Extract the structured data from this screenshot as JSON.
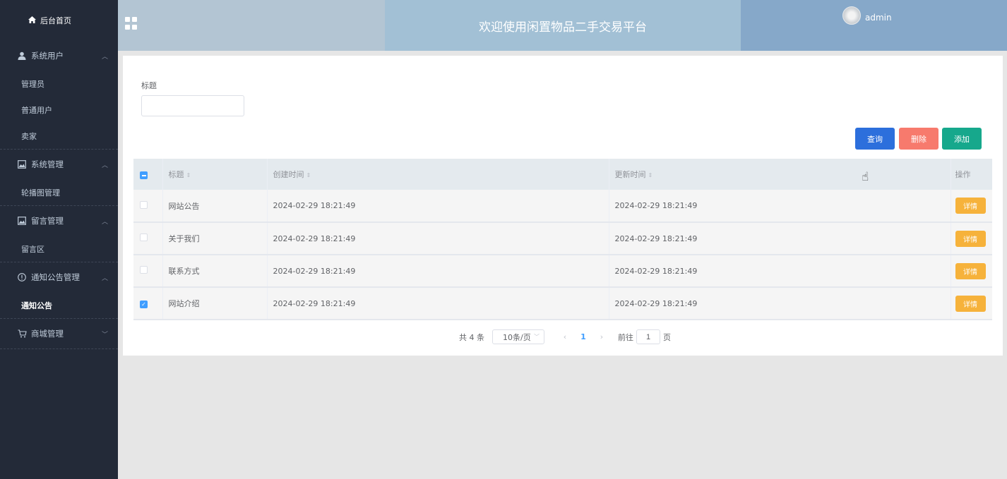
{
  "sidebar": {
    "home_label": "后台首页",
    "groups": [
      {
        "label": "系统用户",
        "icon": "user-icon",
        "items": [
          "管理员",
          "普通用户",
          "卖家"
        ]
      },
      {
        "label": "系统管理",
        "icon": "picture-icon",
        "items": [
          "轮播图管理"
        ]
      },
      {
        "label": "留言管理",
        "icon": "picture-icon",
        "items": [
          "留言区"
        ]
      },
      {
        "label": "通知公告管理",
        "icon": "info-icon",
        "items": [
          "通知公告"
        ]
      },
      {
        "label": "商城管理",
        "icon": "cart-icon",
        "items": []
      }
    ]
  },
  "header": {
    "title": "欢迎使用闲置物品二手交易平台",
    "username": "admin"
  },
  "search": {
    "label": "标题",
    "value": ""
  },
  "toolbar": {
    "query": "查询",
    "delete": "删除",
    "add": "添加"
  },
  "table": {
    "columns": [
      "标题",
      "创建时间",
      "更新时间",
      "操作"
    ],
    "rows": [
      {
        "title": "网站公告",
        "created": "2024-02-29 18:21:49",
        "updated": "2024-02-29 18:21:49",
        "action": "详情",
        "checked": false
      },
      {
        "title": "关于我们",
        "created": "2024-02-29 18:21:49",
        "updated": "2024-02-29 18:21:49",
        "action": "详情",
        "checked": false
      },
      {
        "title": "联系方式",
        "created": "2024-02-29 18:21:49",
        "updated": "2024-02-29 18:21:49",
        "action": "详情",
        "checked": false
      },
      {
        "title": "网站介绍",
        "created": "2024-02-29 18:21:49",
        "updated": "2024-02-29 18:21:49",
        "action": "详情",
        "checked": true
      }
    ]
  },
  "pagination": {
    "total": "共 4 条",
    "page_size": "10条/页",
    "current_page": "1",
    "goto_label": "前往",
    "goto_value": "1",
    "page_suffix": "页"
  },
  "colors": {
    "sidebar_bg": "#232a38",
    "primary": "#2c6fdc",
    "danger": "#f77a6d",
    "success": "#16a88c",
    "warning": "#f6b23b"
  }
}
